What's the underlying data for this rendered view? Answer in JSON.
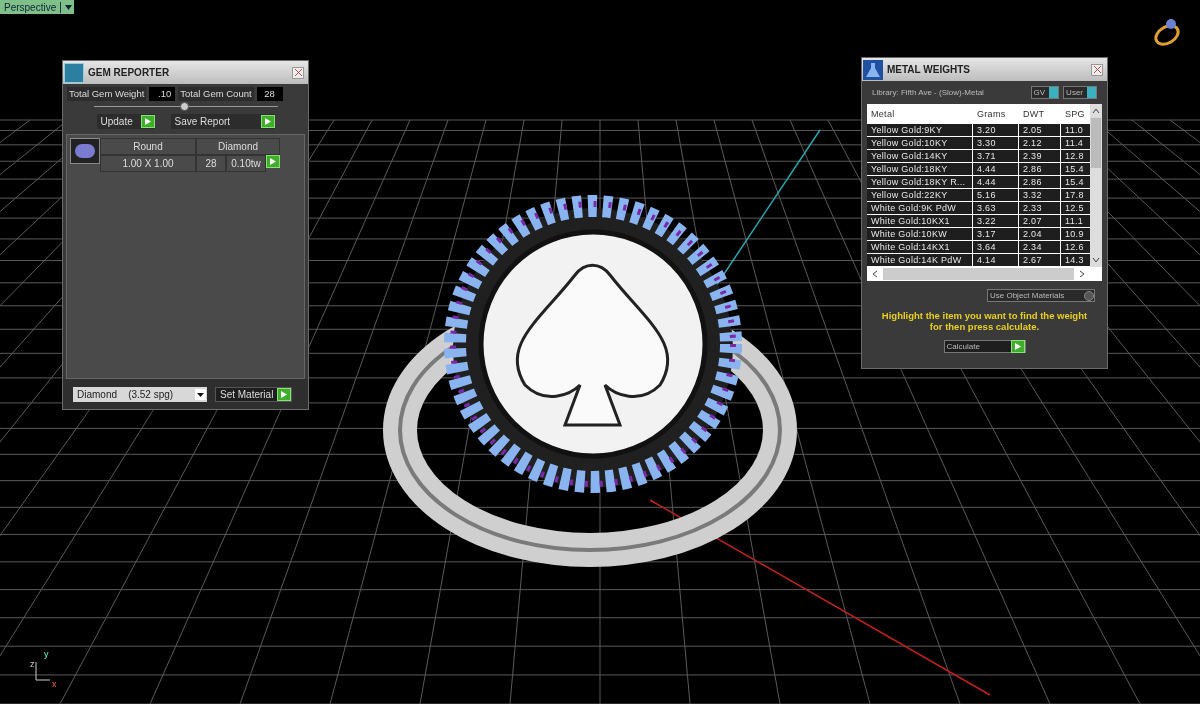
{
  "viewport": {
    "view_menu": "Perspective",
    "axes": [
      "y",
      "z",
      "x"
    ]
  },
  "gem_reporter": {
    "title": "GEM REPORTER",
    "total_weight_label": "Total Gem Weight",
    "total_weight": ".10",
    "total_count_label": "Total Gem Count",
    "total_count": "28",
    "slider": {
      "level": 0.49
    },
    "buttons": [
      "Update",
      "Save Report"
    ],
    "gems": [
      {
        "shape": "Round",
        "size": "1.00 X 1.00",
        "material": "Diamond",
        "count": "28",
        "weight": "0.10tw"
      }
    ],
    "material_select": "Diamond    (3.52 spg)",
    "set_material": "Set Material"
  },
  "metal_weights": {
    "title": "METAL WEIGHTS",
    "library": "Library: Fifth Ave - (Slow)-Metal",
    "toggles": [
      "GV",
      "User"
    ],
    "columns": [
      "Metal",
      "Grams",
      "DWT",
      "SPG"
    ],
    "rows": [
      {
        "metal": "Yellow Gold:9KY",
        "grams": "3.20",
        "dwt": "2.05",
        "spg": "11.0"
      },
      {
        "metal": "Yellow Gold:10KY",
        "grams": "3.30",
        "dwt": "2.12",
        "spg": "11.4"
      },
      {
        "metal": "Yellow Gold:14KY",
        "grams": "3.71",
        "dwt": "2.39",
        "spg": "12.8"
      },
      {
        "metal": "Yellow Gold:18KY",
        "grams": "4.44",
        "dwt": "2.86",
        "spg": "15.4"
      },
      {
        "metal": "Yellow Gold:18KY R...",
        "grams": "4.44",
        "dwt": "2.86",
        "spg": "15.4"
      },
      {
        "metal": "Yellow Gold:22KY",
        "grams": "5.16",
        "dwt": "3.32",
        "spg": "17.8"
      },
      {
        "metal": "White Gold:9K PdW",
        "grams": "3.63",
        "dwt": "2.33",
        "spg": "12.5"
      },
      {
        "metal": "White Gold:10KX1",
        "grams": "3.22",
        "dwt": "2.07",
        "spg": "11.1"
      },
      {
        "metal": "White Gold:10KW",
        "grams": "3.17",
        "dwt": "2.04",
        "spg": "10.9"
      },
      {
        "metal": "White Gold:14KX1",
        "grams": "3.64",
        "dwt": "2.34",
        "spg": "12.6"
      },
      {
        "metal": "White Gold:14K PdW",
        "grams": "4.14",
        "dwt": "2.67",
        "spg": "14.3"
      }
    ],
    "use_object_materials": "Use Object Materials",
    "hint": "Highlight the item you want to find the weight for then press calculate.",
    "calculate": "Calculate"
  }
}
